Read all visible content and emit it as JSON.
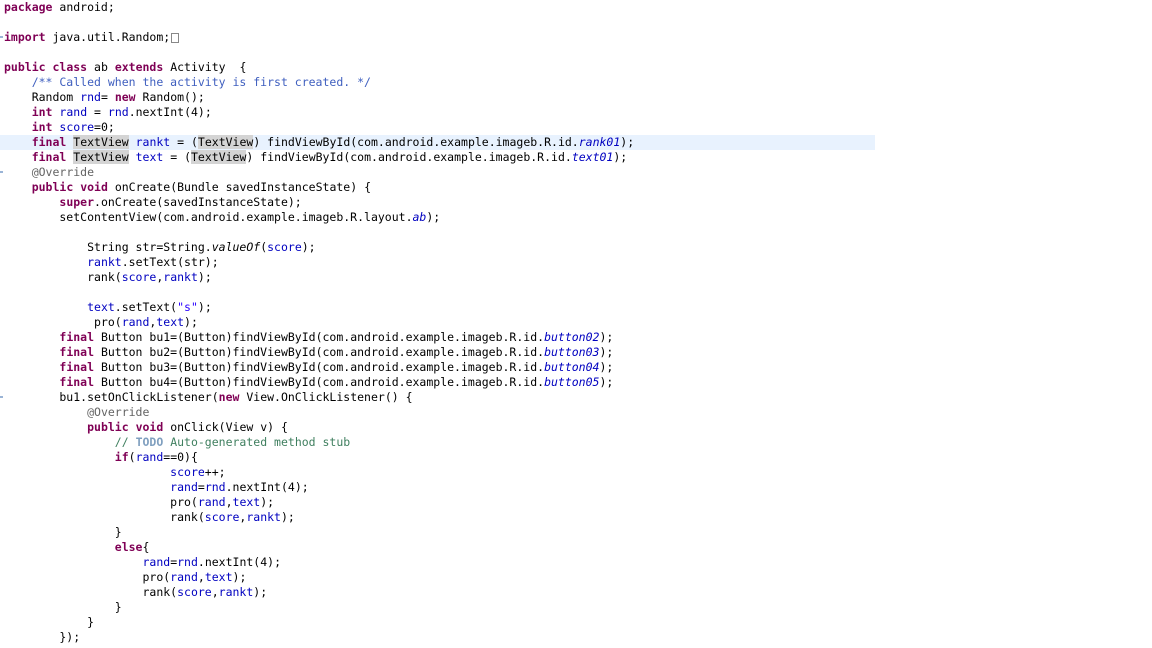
{
  "editor": {
    "lines": [
      "package android;",
      "",
      "import java.util.Random;",
      "",
      "public class ab extends Activity  {",
      "    /** Called when the activity is first created. */",
      "    Random rnd= new Random();",
      "    int rand = rnd.nextInt(4);",
      "    int score=0;",
      "    final TextView rankt = (TextView) findViewById(com.android.example.imageb.R.id.rank01);",
      "    final TextView text = (TextView) findViewById(com.android.example.imageb.R.id.text01);",
      "    @Override",
      "    public void onCreate(Bundle savedInstanceState) {",
      "        super.onCreate(savedInstanceState);",
      "        setContentView(com.android.example.imageb.R.layout.ab);",
      "",
      "            String str=String.valueOf(score);",
      "            rankt.setText(str);",
      "            rank(score,rankt);",
      "",
      "            text.setText(\"s\");",
      "             pro(rand,text);",
      "        final Button bu1=(Button)findViewById(com.android.example.imageb.R.id.button02);",
      "        final Button bu2=(Button)findViewById(com.android.example.imageb.R.id.button03);",
      "        final Button bu3=(Button)findViewById(com.android.example.imageb.R.id.button04);",
      "        final Button bu4=(Button)findViewById(com.android.example.imageb.R.id.button05);",
      "        bu1.setOnClickListener(new View.OnClickListener() {",
      "            @Override",
      "            public void onClick(View v) {",
      "                // TODO Auto-generated method stub",
      "                if(rand==0){",
      "                        score++;",
      "                        rand=rnd.nextInt(4);",
      "                        pro(rand,text);",
      "                        rank(score,rankt);",
      "                }",
      "                else{",
      "                    rand=rnd.nextInt(4);",
      "                    pro(rand,text);",
      "                    rank(score,rankt);",
      "                }",
      "            }",
      "        });"
    ],
    "current_line_index": 9
  }
}
